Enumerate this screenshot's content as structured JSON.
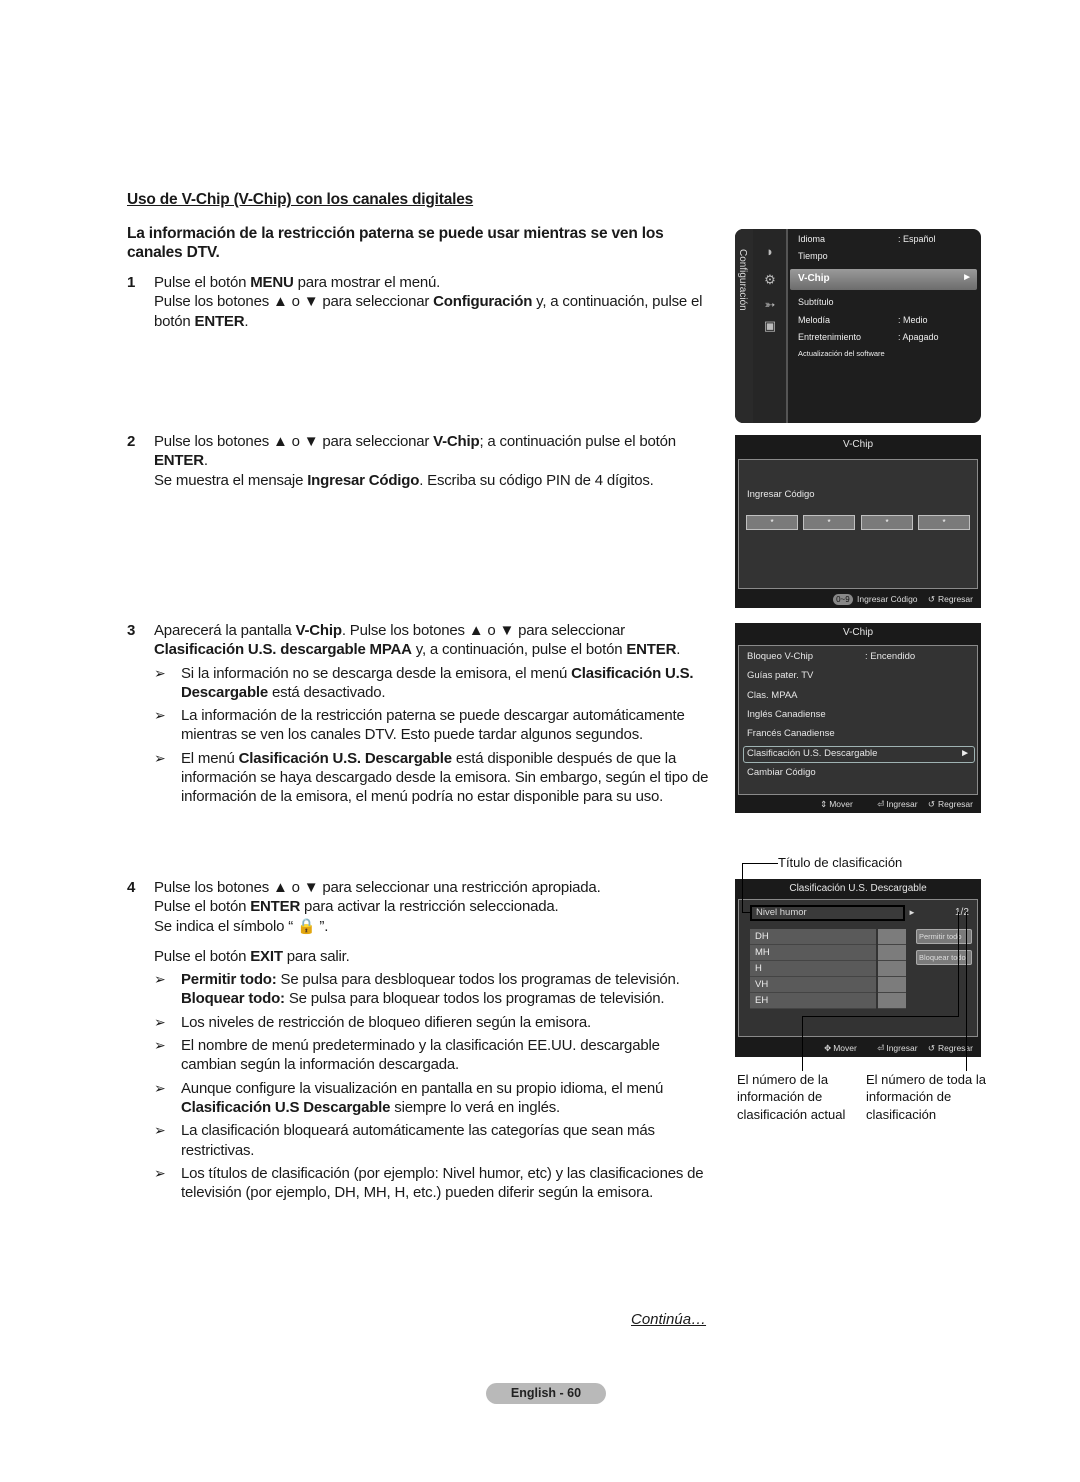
{
  "section_title": "Uso de V-Chip (V-Chip) con los canales digitales",
  "intro": "La información de la restricción paterna se puede usar mientras se ven los canales DTV.",
  "steps": [
    {
      "num": "1",
      "lines": [
        [
          "Pulse el botón ",
          {
            "b": "MENU"
          },
          " para mostrar el menú."
        ],
        [
          "Pulse los botones ▲ o ▼ para seleccionar ",
          {
            "b": "Configuración"
          },
          " y, a continuación, pulse el botón ",
          {
            "b": "ENTER"
          },
          "."
        ]
      ]
    },
    {
      "num": "2",
      "lines": [
        [
          "Pulse los botones ▲ o ▼ para seleccionar ",
          {
            "b": "V-Chip"
          },
          "; a continuación pulse el botón ",
          {
            "b": "ENTER"
          },
          "."
        ],
        [
          "Se muestra el mensaje ",
          {
            "b": "Ingresar Código"
          },
          ". Escriba su código PIN de 4 dígitos."
        ]
      ]
    },
    {
      "num": "3",
      "lines": [
        [
          "Aparecerá la pantalla ",
          {
            "b": "V-Chip"
          },
          ". Pulse los botones ▲ o ▼ para seleccionar ",
          {
            "b": "Clasificación U.S. descargable MPAA"
          },
          " y, a continuación, pulse el botón ",
          {
            "b": "ENTER"
          },
          "."
        ]
      ],
      "notes": [
        [
          "Si la información no se descarga desde la emisora, el menú ",
          {
            "b": "Clasificación U.S. Descargable"
          },
          " está desactivado."
        ],
        [
          "La información de la restricción paterna se puede descargar automáticamente mientras se ven los canales DTV. Esto puede tardar algunos segundos."
        ],
        [
          "El menú ",
          {
            "b": "Clasificación U.S. Descargable"
          },
          " está disponible después de que la información se haya descargado desde la emisora. Sin embargo, según el tipo de información de la emisora, el menú podría no estar disponible para su uso."
        ]
      ]
    },
    {
      "num": "4",
      "lines": [
        [
          "Pulse los botones ▲ o ▼ para seleccionar una restricción apropiada."
        ],
        [
          "Pulse el botón ",
          {
            "b": "ENTER"
          },
          " para activar la restricción seleccionada."
        ],
        [
          "Se indica el símbolo “ 🔒 ”."
        ],
        [
          "__gap__"
        ],
        [
          "Pulse el botón ",
          {
            "b": "EXIT"
          },
          " para salir."
        ]
      ],
      "notes": [
        [
          {
            "b": "Permitir todo:"
          },
          " Se pulsa para desbloquear todos los programas de televisión.",
          {
            "br": true
          },
          {
            "b": "Bloquear todo:"
          },
          " Se pulsa para bloquear todos los programas de televisión."
        ],
        [
          "Los niveles de restricción de bloqueo difieren según la emisora."
        ],
        [
          "El nombre de menú predeterminado y la clasificación EE.UU. descargable cambian según la información descargada."
        ],
        [
          "Aunque configure la visualización en pantalla en su propio idioma, el menú ",
          {
            "b": "Clasificación U.S Descargable"
          },
          " siempre lo verá en inglés."
        ],
        [
          "La clasificación bloqueará automáticamente las categorías que sean más restrictivas."
        ],
        [
          "Los títulos de clasificación (por ejemplo: Nivel humor, etc) y las clasificaciones de televisión (por ejemplo, DH, MH, H, etc.) pueden diferir según la emisora."
        ]
      ]
    }
  ],
  "note_arrow": "➢",
  "continua": "Continúa…",
  "page_label": "English - 60",
  "screen_setup": {
    "side_label": "Configuración",
    "icons": [
      "satellite-dish-icon",
      "gear-icon",
      "input-icon",
      "picture-icon"
    ],
    "items": [
      {
        "label": "Idioma",
        "value": ": Español"
      },
      {
        "label": "Tiempo",
        "value": ""
      },
      {
        "label": "V-Chip",
        "value": "",
        "selected": true
      },
      {
        "label": "Subtítulo",
        "value": ""
      },
      {
        "label": "Melodía",
        "value": ": Medio"
      },
      {
        "label": "Entretenimiento",
        "value": ": Apagado"
      },
      {
        "label": "Actualización del software",
        "value": ""
      }
    ],
    "selected_arrow": "►"
  },
  "screen_pin": {
    "title": "V-Chip",
    "prompt": "Ingresar Código",
    "digits": [
      "*",
      "*",
      "*",
      "*"
    ],
    "footer": {
      "key": "0~9",
      "enter_label": "Ingresar Código",
      "back_icon": "↺",
      "back_label": "Regresar"
    }
  },
  "screen_vchip": {
    "title": "V-Chip",
    "items": [
      {
        "label": "Bloqueo V-Chip",
        "value": ": Encendido"
      },
      {
        "label": "Guías pater. TV",
        "value": ""
      },
      {
        "label": "Clas. MPAA",
        "value": ""
      },
      {
        "label": "Inglés Canadiense",
        "value": ""
      },
      {
        "label": "Francés Canadiense",
        "value": ""
      },
      {
        "label": "Clasificación U.S. Descargable",
        "value": "",
        "selected": true
      },
      {
        "label": "Cambiar Código",
        "value": ""
      }
    ],
    "selected_arrow": "►",
    "footer": {
      "move_icon": "⇕",
      "move_label": "Mover",
      "enter_icon": "⏎",
      "enter_label": "Ingresar",
      "back_icon": "↺",
      "back_label": "Regresar"
    }
  },
  "screen_rating": {
    "callout_title": "Título de clasificación",
    "title": "Clasificación U.S. Descargable",
    "category": "Nivel humor",
    "category_arrow": "►",
    "page": "1/2",
    "ratings": [
      "DH",
      "MH",
      "H",
      "VH",
      "EH"
    ],
    "allow_all": "Permitir todo",
    "block_all": "Bloquear todo",
    "footer": {
      "move_icon": "✥",
      "move_label": "Mover",
      "enter_icon": "⏎",
      "enter_label": "Ingresar",
      "back_icon": "↺",
      "back_label": "Regresar"
    },
    "callout_current": "El número de la información de clasificación actual",
    "callout_total": "El número de toda la información de clasificación"
  }
}
